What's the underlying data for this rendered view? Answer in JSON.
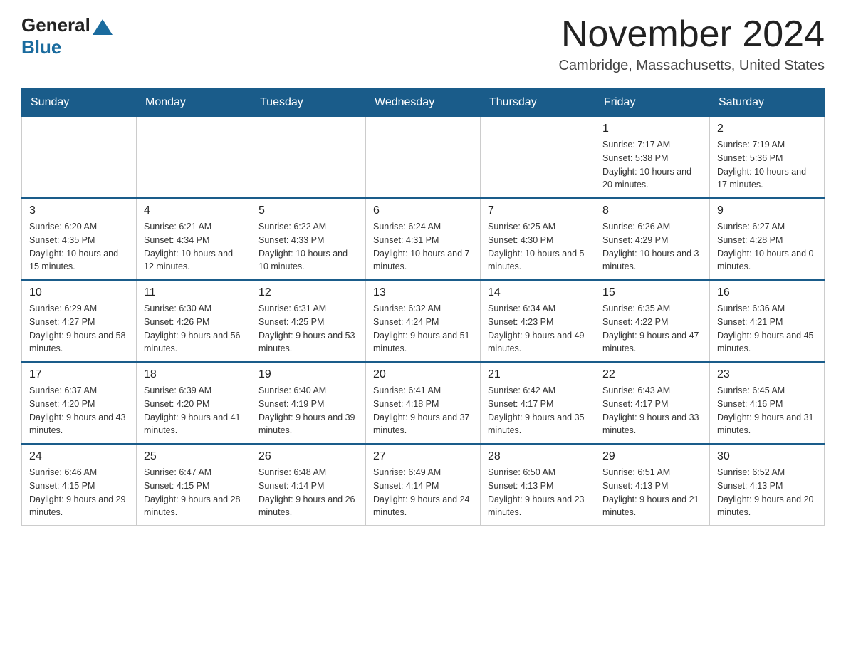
{
  "logo": {
    "general": "General",
    "blue": "Blue"
  },
  "title": "November 2024",
  "location": "Cambridge, Massachusetts, United States",
  "days_header": [
    "Sunday",
    "Monday",
    "Tuesday",
    "Wednesday",
    "Thursday",
    "Friday",
    "Saturday"
  ],
  "weeks": [
    [
      {
        "day": "",
        "sunrise": "",
        "sunset": "",
        "daylight": ""
      },
      {
        "day": "",
        "sunrise": "",
        "sunset": "",
        "daylight": ""
      },
      {
        "day": "",
        "sunrise": "",
        "sunset": "",
        "daylight": ""
      },
      {
        "day": "",
        "sunrise": "",
        "sunset": "",
        "daylight": ""
      },
      {
        "day": "",
        "sunrise": "",
        "sunset": "",
        "daylight": ""
      },
      {
        "day": "1",
        "sunrise": "Sunrise: 7:17 AM",
        "sunset": "Sunset: 5:38 PM",
        "daylight": "Daylight: 10 hours and 20 minutes."
      },
      {
        "day": "2",
        "sunrise": "Sunrise: 7:19 AM",
        "sunset": "Sunset: 5:36 PM",
        "daylight": "Daylight: 10 hours and 17 minutes."
      }
    ],
    [
      {
        "day": "3",
        "sunrise": "Sunrise: 6:20 AM",
        "sunset": "Sunset: 4:35 PM",
        "daylight": "Daylight: 10 hours and 15 minutes."
      },
      {
        "day": "4",
        "sunrise": "Sunrise: 6:21 AM",
        "sunset": "Sunset: 4:34 PM",
        "daylight": "Daylight: 10 hours and 12 minutes."
      },
      {
        "day": "5",
        "sunrise": "Sunrise: 6:22 AM",
        "sunset": "Sunset: 4:33 PM",
        "daylight": "Daylight: 10 hours and 10 minutes."
      },
      {
        "day": "6",
        "sunrise": "Sunrise: 6:24 AM",
        "sunset": "Sunset: 4:31 PM",
        "daylight": "Daylight: 10 hours and 7 minutes."
      },
      {
        "day": "7",
        "sunrise": "Sunrise: 6:25 AM",
        "sunset": "Sunset: 4:30 PM",
        "daylight": "Daylight: 10 hours and 5 minutes."
      },
      {
        "day": "8",
        "sunrise": "Sunrise: 6:26 AM",
        "sunset": "Sunset: 4:29 PM",
        "daylight": "Daylight: 10 hours and 3 minutes."
      },
      {
        "day": "9",
        "sunrise": "Sunrise: 6:27 AM",
        "sunset": "Sunset: 4:28 PM",
        "daylight": "Daylight: 10 hours and 0 minutes."
      }
    ],
    [
      {
        "day": "10",
        "sunrise": "Sunrise: 6:29 AM",
        "sunset": "Sunset: 4:27 PM",
        "daylight": "Daylight: 9 hours and 58 minutes."
      },
      {
        "day": "11",
        "sunrise": "Sunrise: 6:30 AM",
        "sunset": "Sunset: 4:26 PM",
        "daylight": "Daylight: 9 hours and 56 minutes."
      },
      {
        "day": "12",
        "sunrise": "Sunrise: 6:31 AM",
        "sunset": "Sunset: 4:25 PM",
        "daylight": "Daylight: 9 hours and 53 minutes."
      },
      {
        "day": "13",
        "sunrise": "Sunrise: 6:32 AM",
        "sunset": "Sunset: 4:24 PM",
        "daylight": "Daylight: 9 hours and 51 minutes."
      },
      {
        "day": "14",
        "sunrise": "Sunrise: 6:34 AM",
        "sunset": "Sunset: 4:23 PM",
        "daylight": "Daylight: 9 hours and 49 minutes."
      },
      {
        "day": "15",
        "sunrise": "Sunrise: 6:35 AM",
        "sunset": "Sunset: 4:22 PM",
        "daylight": "Daylight: 9 hours and 47 minutes."
      },
      {
        "day": "16",
        "sunrise": "Sunrise: 6:36 AM",
        "sunset": "Sunset: 4:21 PM",
        "daylight": "Daylight: 9 hours and 45 minutes."
      }
    ],
    [
      {
        "day": "17",
        "sunrise": "Sunrise: 6:37 AM",
        "sunset": "Sunset: 4:20 PM",
        "daylight": "Daylight: 9 hours and 43 minutes."
      },
      {
        "day": "18",
        "sunrise": "Sunrise: 6:39 AM",
        "sunset": "Sunset: 4:20 PM",
        "daylight": "Daylight: 9 hours and 41 minutes."
      },
      {
        "day": "19",
        "sunrise": "Sunrise: 6:40 AM",
        "sunset": "Sunset: 4:19 PM",
        "daylight": "Daylight: 9 hours and 39 minutes."
      },
      {
        "day": "20",
        "sunrise": "Sunrise: 6:41 AM",
        "sunset": "Sunset: 4:18 PM",
        "daylight": "Daylight: 9 hours and 37 minutes."
      },
      {
        "day": "21",
        "sunrise": "Sunrise: 6:42 AM",
        "sunset": "Sunset: 4:17 PM",
        "daylight": "Daylight: 9 hours and 35 minutes."
      },
      {
        "day": "22",
        "sunrise": "Sunrise: 6:43 AM",
        "sunset": "Sunset: 4:17 PM",
        "daylight": "Daylight: 9 hours and 33 minutes."
      },
      {
        "day": "23",
        "sunrise": "Sunrise: 6:45 AM",
        "sunset": "Sunset: 4:16 PM",
        "daylight": "Daylight: 9 hours and 31 minutes."
      }
    ],
    [
      {
        "day": "24",
        "sunrise": "Sunrise: 6:46 AM",
        "sunset": "Sunset: 4:15 PM",
        "daylight": "Daylight: 9 hours and 29 minutes."
      },
      {
        "day": "25",
        "sunrise": "Sunrise: 6:47 AM",
        "sunset": "Sunset: 4:15 PM",
        "daylight": "Daylight: 9 hours and 28 minutes."
      },
      {
        "day": "26",
        "sunrise": "Sunrise: 6:48 AM",
        "sunset": "Sunset: 4:14 PM",
        "daylight": "Daylight: 9 hours and 26 minutes."
      },
      {
        "day": "27",
        "sunrise": "Sunrise: 6:49 AM",
        "sunset": "Sunset: 4:14 PM",
        "daylight": "Daylight: 9 hours and 24 minutes."
      },
      {
        "day": "28",
        "sunrise": "Sunrise: 6:50 AM",
        "sunset": "Sunset: 4:13 PM",
        "daylight": "Daylight: 9 hours and 23 minutes."
      },
      {
        "day": "29",
        "sunrise": "Sunrise: 6:51 AM",
        "sunset": "Sunset: 4:13 PM",
        "daylight": "Daylight: 9 hours and 21 minutes."
      },
      {
        "day": "30",
        "sunrise": "Sunrise: 6:52 AM",
        "sunset": "Sunset: 4:13 PM",
        "daylight": "Daylight: 9 hours and 20 minutes."
      }
    ]
  ]
}
